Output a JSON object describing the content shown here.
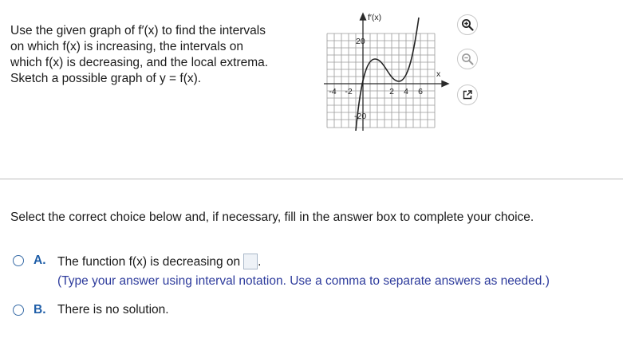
{
  "question": {
    "lines": [
      "Use the given graph of f′(x) to find the intervals",
      "on which f(x) is increasing, the intervals on",
      "which f(x) is decreasing, and the local extrema.",
      "Sketch a possible graph of y = f(x)."
    ]
  },
  "graph": {
    "y_label": "f′(x)",
    "x_label": "x",
    "x_ticks": [
      "-4",
      "-2",
      "2",
      "4",
      "6"
    ],
    "y_ticks": [
      "20",
      "-20"
    ]
  },
  "tools": {
    "zoom_in": "zoom-in-icon",
    "zoom_out": "zoom-out-icon",
    "popout": "popout-icon"
  },
  "instruction": "Select the correct choice below and, if necessary, fill in the answer box to complete your choice.",
  "choices": [
    {
      "letter": "A.",
      "text_before": "The function f(x) is decreasing on",
      "text_after": ".",
      "hint": "(Type your answer using interval notation. Use a comma to separate answers as needed.)"
    },
    {
      "letter": "B.",
      "text": "There is no solution."
    }
  ],
  "colors": {
    "accent": "#1f5ea8",
    "hint": "#2d3b9c",
    "grid": "#9a9a9a"
  }
}
